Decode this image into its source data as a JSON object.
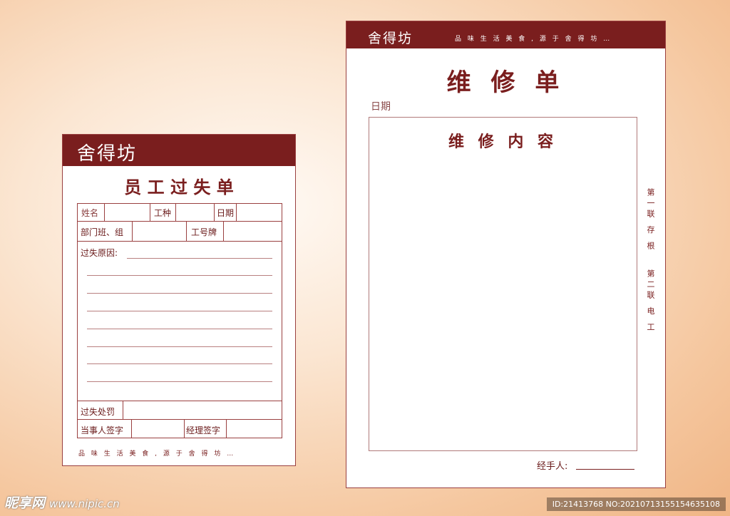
{
  "left_form": {
    "brand": "舍得坊",
    "title": "员 工 过 失 单",
    "fields": {
      "name": "姓名",
      "job_type": "工种",
      "date": "日期",
      "department": "部门班、组",
      "badge": "工号牌",
      "reason": "过失原因:",
      "penalty": "过失处罚",
      "party_signature": "当事人签字",
      "manager_signature": "经理签字"
    },
    "slogan": "品 味 生 活 美 食 , 源 于 舍 得 坊 …"
  },
  "right_form": {
    "brand": "舍得坊",
    "header_slogan": "品 味 生 活 美 食 , 源 于 舍 得 坊 …",
    "title": "维 修 单",
    "date_label": "日期",
    "content_title": "维 修 内 容",
    "copy_labels": [
      "第一联 存 根",
      "第二联 电 工"
    ],
    "handler_label": "经手人:"
  },
  "watermark": {
    "site": "昵享网",
    "url": "www.nipic.cn",
    "id_text": "ID:21413768 NO:20210713155154635108"
  },
  "colors": {
    "brand": "#7a1e1e",
    "background_center": "#fffaf5",
    "background_edge": "#f0b585"
  }
}
